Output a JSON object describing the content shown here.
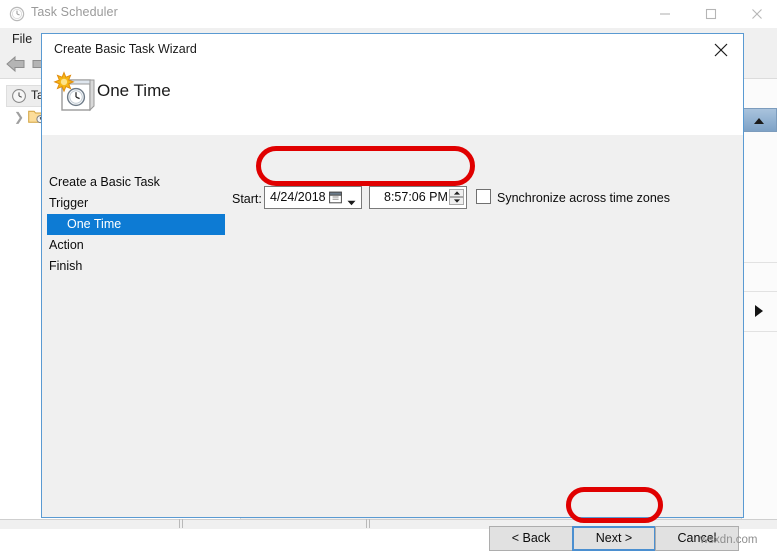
{
  "background_window": {
    "title": "Task Scheduler",
    "title_icon": "clock-icon",
    "window_controls": {
      "minimize": "minimize-icon",
      "maximize": "maximize-icon",
      "close": "close-icon"
    },
    "menu": {
      "file": "File"
    },
    "toolbar": {
      "back": "back-arrow-icon",
      "forward": "forward-arrow-icon"
    },
    "tree": {
      "root_label": "Tas",
      "root_icon": "clock-icon",
      "child_icon": "folder-clock-icon",
      "child_chevron": "chevron-right-icon"
    },
    "right_panel": {
      "scroll_up": "scroll-up-arrow-icon",
      "expander": "expander-triangle-icon"
    }
  },
  "dialog": {
    "title": "Create Basic Task Wizard",
    "close_icon": "close-icon",
    "header": {
      "icon": "one-time-calendar-clock-icon",
      "title": "One Time"
    },
    "nav": {
      "items": [
        {
          "label": "Create a Basic Task",
          "selected": false,
          "indent": false
        },
        {
          "label": "Trigger",
          "selected": false,
          "indent": false
        },
        {
          "label": "One Time",
          "selected": true,
          "indent": true
        },
        {
          "label": "Action",
          "selected": false,
          "indent": false
        },
        {
          "label": "Finish",
          "selected": false,
          "indent": false
        }
      ]
    },
    "form": {
      "start_label": "Start:",
      "date_value": "4/24/2018",
      "date_calendar_icon": "calendar-icon",
      "date_dropdown_icon": "chevron-down-icon",
      "time_value": "8:57:06 PM",
      "time_spinner_up_icon": "spinner-up-icon",
      "time_spinner_down_icon": "spinner-down-icon",
      "sync_checkbox_checked": false,
      "sync_label": "Synchronize across time zones"
    },
    "buttons": {
      "back": "< Back",
      "next": "Next >",
      "cancel": "Cancel"
    }
  },
  "annotations": {
    "color": "#e00000",
    "highlighted": [
      "start-date-time-fields",
      "next-button"
    ]
  },
  "watermark": "wsxdn.com"
}
